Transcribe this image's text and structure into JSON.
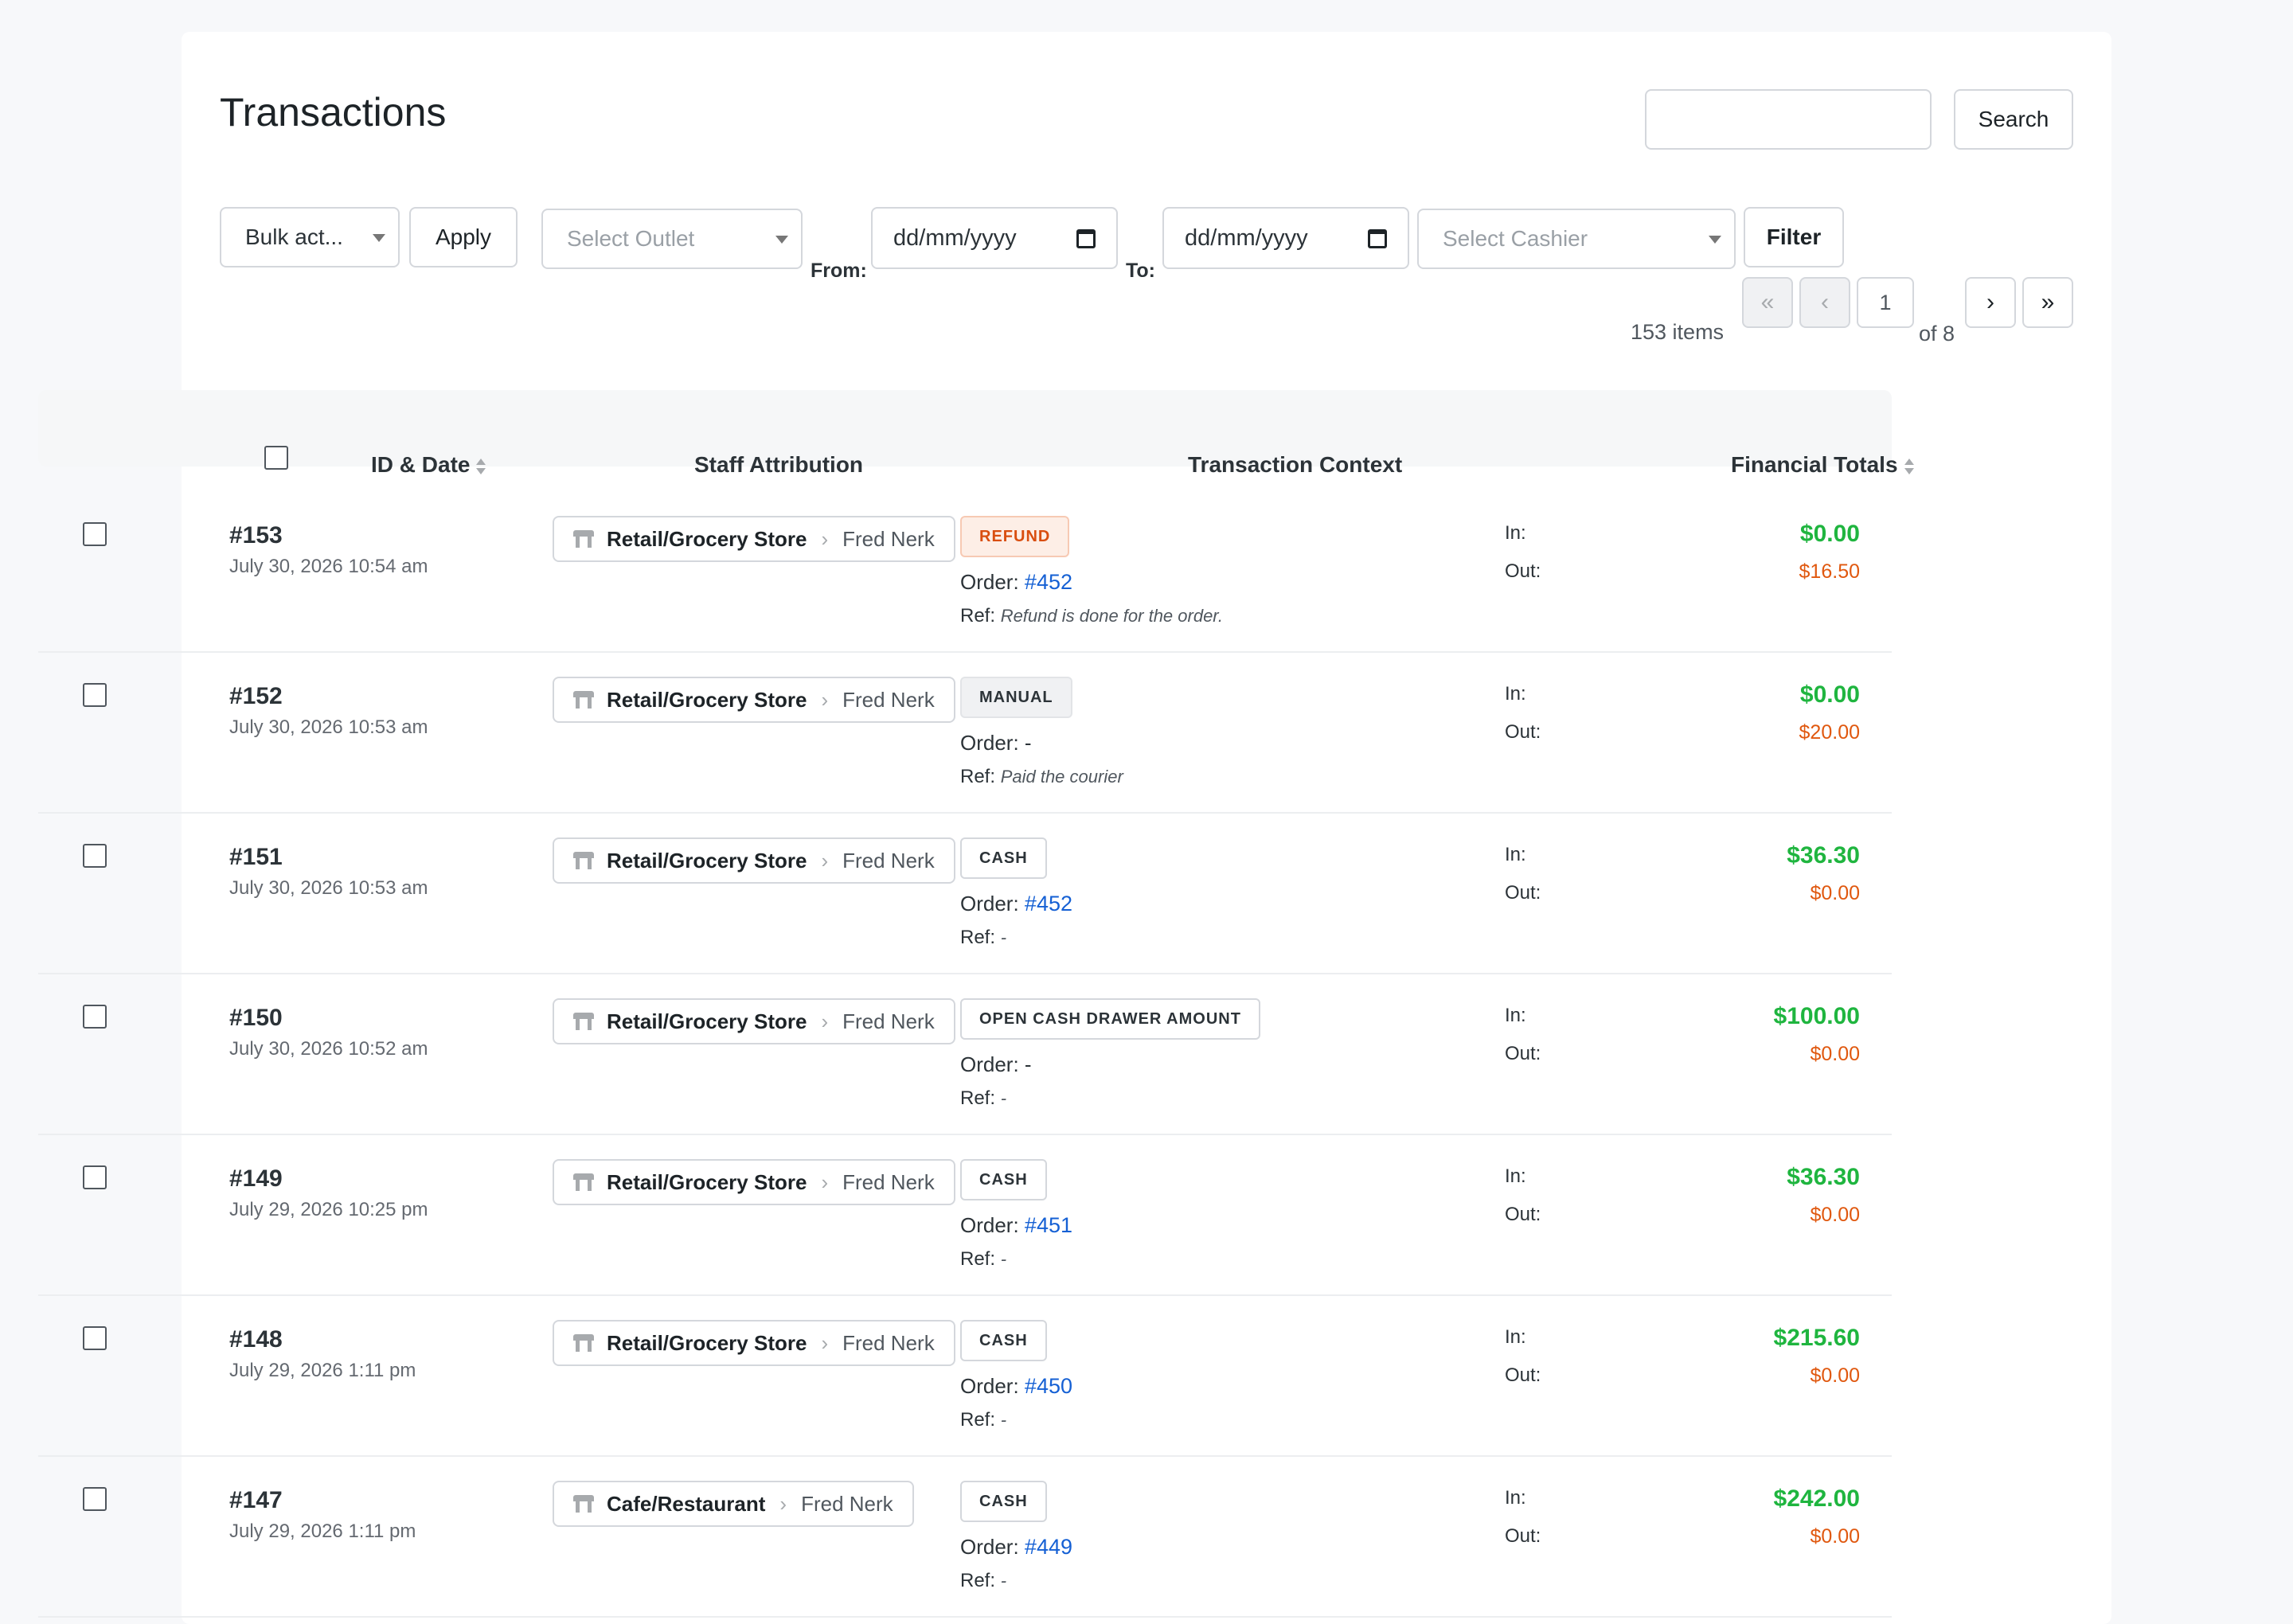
{
  "page": {
    "title": "Transactions"
  },
  "search": {
    "placeholder": "",
    "button_label": "Search"
  },
  "filters": {
    "bulk_label": "Bulk act...",
    "apply_label": "Apply",
    "outlet_placeholder": "Select Outlet",
    "from_label": "From:",
    "from_value": "dd/mm/yyyy",
    "to_label": "To:",
    "to_value": "dd/mm/yyyy",
    "cashier_placeholder": "Select Cashier",
    "filter_label": "Filter"
  },
  "pagination": {
    "items_text": "153 items",
    "first": "«",
    "prev": "‹",
    "current_page": "1",
    "of_text": "of 8",
    "next": "›",
    "last": "»"
  },
  "table": {
    "headers": {
      "id_date": "ID & Date",
      "staff": "Staff Attribution",
      "context": "Transaction Context",
      "totals": "Financial Totals"
    },
    "labels": {
      "order": "Order:",
      "ref": "Ref:",
      "in": "In:",
      "out": "Out:"
    },
    "rows": [
      {
        "id": "#153",
        "date": "July 30, 2026 10:54 am",
        "store": "Retail/Grocery Store",
        "cashier": "Fred Nerk",
        "type": "REFUND",
        "order": "#452",
        "ref": "Refund is done for the order.",
        "in": "$0.00",
        "out": "$16.50"
      },
      {
        "id": "#152",
        "date": "July 30, 2026 10:53 am",
        "store": "Retail/Grocery Store",
        "cashier": "Fred Nerk",
        "type": "MANUAL",
        "order": "-",
        "ref": "Paid the courier",
        "in": "$0.00",
        "out": "$20.00"
      },
      {
        "id": "#151",
        "date": "July 30, 2026 10:53 am",
        "store": "Retail/Grocery Store",
        "cashier": "Fred Nerk",
        "type": "CASH",
        "order": "#452",
        "ref": "-",
        "in": "$36.30",
        "out": "$0.00"
      },
      {
        "id": "#150",
        "date": "July 30, 2026 10:52 am",
        "store": "Retail/Grocery Store",
        "cashier": "Fred Nerk",
        "type": "OPEN CASH DRAWER AMOUNT",
        "order": "-",
        "ref": "-",
        "in": "$100.00",
        "out": "$0.00"
      },
      {
        "id": "#149",
        "date": "July 29, 2026 10:25 pm",
        "store": "Retail/Grocery Store",
        "cashier": "Fred Nerk",
        "type": "CASH",
        "order": "#451",
        "ref": "-",
        "in": "$36.30",
        "out": "$0.00"
      },
      {
        "id": "#148",
        "date": "July 29, 2026 1:11 pm",
        "store": "Retail/Grocery Store",
        "cashier": "Fred Nerk",
        "type": "CASH",
        "order": "#450",
        "ref": "-",
        "in": "$215.60",
        "out": "$0.00"
      },
      {
        "id": "#147",
        "date": "July 29, 2026 1:11 pm",
        "store": "Cafe/Restaurant",
        "cashier": "Fred Nerk",
        "type": "CASH",
        "order": "#449",
        "ref": "-",
        "in": "$242.00",
        "out": "$0.00"
      }
    ]
  },
  "colors": {
    "in_green": "#1fb53f",
    "out_orange": "#e0580f",
    "link_blue": "#1560d4",
    "refund_badge": "#d94e0f"
  }
}
